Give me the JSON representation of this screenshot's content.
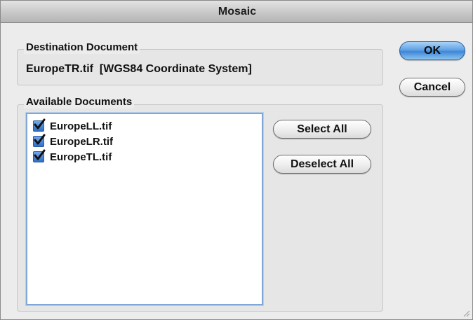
{
  "window": {
    "title": "Mosaic"
  },
  "destination": {
    "group_title": "Destination Document",
    "value": "EuropeTR.tif  [WGS84 Coordinate System]"
  },
  "available": {
    "group_title": "Available Documents",
    "documents": [
      {
        "name": "EuropeLL.tif",
        "checked": true
      },
      {
        "name": "EuropeLR.tif",
        "checked": true
      },
      {
        "name": "EuropeTL.tif",
        "checked": true
      }
    ]
  },
  "buttons": {
    "ok": "OK",
    "cancel": "Cancel",
    "select_all": "Select All",
    "deselect_all": "Deselect All"
  },
  "colors": {
    "accent": "#3f86d6",
    "checkbox": "#2e6fc5",
    "list_border": "#7fa8d8"
  }
}
